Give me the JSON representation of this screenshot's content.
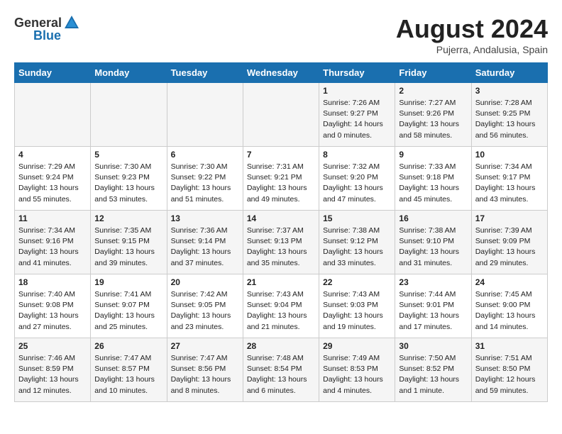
{
  "header": {
    "logo_general": "General",
    "logo_blue": "Blue",
    "month_year": "August 2024",
    "location": "Pujerra, Andalusia, Spain"
  },
  "days_of_week": [
    "Sunday",
    "Monday",
    "Tuesday",
    "Wednesday",
    "Thursday",
    "Friday",
    "Saturday"
  ],
  "weeks": [
    [
      {
        "day": "",
        "sunrise": "",
        "sunset": "",
        "daylight": ""
      },
      {
        "day": "",
        "sunrise": "",
        "sunset": "",
        "daylight": ""
      },
      {
        "day": "",
        "sunrise": "",
        "sunset": "",
        "daylight": ""
      },
      {
        "day": "",
        "sunrise": "",
        "sunset": "",
        "daylight": ""
      },
      {
        "day": "1",
        "sunrise": "Sunrise: 7:26 AM",
        "sunset": "Sunset: 9:27 PM",
        "daylight": "Daylight: 14 hours and 0 minutes."
      },
      {
        "day": "2",
        "sunrise": "Sunrise: 7:27 AM",
        "sunset": "Sunset: 9:26 PM",
        "daylight": "Daylight: 13 hours and 58 minutes."
      },
      {
        "day": "3",
        "sunrise": "Sunrise: 7:28 AM",
        "sunset": "Sunset: 9:25 PM",
        "daylight": "Daylight: 13 hours and 56 minutes."
      }
    ],
    [
      {
        "day": "4",
        "sunrise": "Sunrise: 7:29 AM",
        "sunset": "Sunset: 9:24 PM",
        "daylight": "Daylight: 13 hours and 55 minutes."
      },
      {
        "day": "5",
        "sunrise": "Sunrise: 7:30 AM",
        "sunset": "Sunset: 9:23 PM",
        "daylight": "Daylight: 13 hours and 53 minutes."
      },
      {
        "day": "6",
        "sunrise": "Sunrise: 7:30 AM",
        "sunset": "Sunset: 9:22 PM",
        "daylight": "Daylight: 13 hours and 51 minutes."
      },
      {
        "day": "7",
        "sunrise": "Sunrise: 7:31 AM",
        "sunset": "Sunset: 9:21 PM",
        "daylight": "Daylight: 13 hours and 49 minutes."
      },
      {
        "day": "8",
        "sunrise": "Sunrise: 7:32 AM",
        "sunset": "Sunset: 9:20 PM",
        "daylight": "Daylight: 13 hours and 47 minutes."
      },
      {
        "day": "9",
        "sunrise": "Sunrise: 7:33 AM",
        "sunset": "Sunset: 9:18 PM",
        "daylight": "Daylight: 13 hours and 45 minutes."
      },
      {
        "day": "10",
        "sunrise": "Sunrise: 7:34 AM",
        "sunset": "Sunset: 9:17 PM",
        "daylight": "Daylight: 13 hours and 43 minutes."
      }
    ],
    [
      {
        "day": "11",
        "sunrise": "Sunrise: 7:34 AM",
        "sunset": "Sunset: 9:16 PM",
        "daylight": "Daylight: 13 hours and 41 minutes."
      },
      {
        "day": "12",
        "sunrise": "Sunrise: 7:35 AM",
        "sunset": "Sunset: 9:15 PM",
        "daylight": "Daylight: 13 hours and 39 minutes."
      },
      {
        "day": "13",
        "sunrise": "Sunrise: 7:36 AM",
        "sunset": "Sunset: 9:14 PM",
        "daylight": "Daylight: 13 hours and 37 minutes."
      },
      {
        "day": "14",
        "sunrise": "Sunrise: 7:37 AM",
        "sunset": "Sunset: 9:13 PM",
        "daylight": "Daylight: 13 hours and 35 minutes."
      },
      {
        "day": "15",
        "sunrise": "Sunrise: 7:38 AM",
        "sunset": "Sunset: 9:12 PM",
        "daylight": "Daylight: 13 hours and 33 minutes."
      },
      {
        "day": "16",
        "sunrise": "Sunrise: 7:38 AM",
        "sunset": "Sunset: 9:10 PM",
        "daylight": "Daylight: 13 hours and 31 minutes."
      },
      {
        "day": "17",
        "sunrise": "Sunrise: 7:39 AM",
        "sunset": "Sunset: 9:09 PM",
        "daylight": "Daylight: 13 hours and 29 minutes."
      }
    ],
    [
      {
        "day": "18",
        "sunrise": "Sunrise: 7:40 AM",
        "sunset": "Sunset: 9:08 PM",
        "daylight": "Daylight: 13 hours and 27 minutes."
      },
      {
        "day": "19",
        "sunrise": "Sunrise: 7:41 AM",
        "sunset": "Sunset: 9:07 PM",
        "daylight": "Daylight: 13 hours and 25 minutes."
      },
      {
        "day": "20",
        "sunrise": "Sunrise: 7:42 AM",
        "sunset": "Sunset: 9:05 PM",
        "daylight": "Daylight: 13 hours and 23 minutes."
      },
      {
        "day": "21",
        "sunrise": "Sunrise: 7:43 AM",
        "sunset": "Sunset: 9:04 PM",
        "daylight": "Daylight: 13 hours and 21 minutes."
      },
      {
        "day": "22",
        "sunrise": "Sunrise: 7:43 AM",
        "sunset": "Sunset: 9:03 PM",
        "daylight": "Daylight: 13 hours and 19 minutes."
      },
      {
        "day": "23",
        "sunrise": "Sunrise: 7:44 AM",
        "sunset": "Sunset: 9:01 PM",
        "daylight": "Daylight: 13 hours and 17 minutes."
      },
      {
        "day": "24",
        "sunrise": "Sunrise: 7:45 AM",
        "sunset": "Sunset: 9:00 PM",
        "daylight": "Daylight: 13 hours and 14 minutes."
      }
    ],
    [
      {
        "day": "25",
        "sunrise": "Sunrise: 7:46 AM",
        "sunset": "Sunset: 8:59 PM",
        "daylight": "Daylight: 13 hours and 12 minutes."
      },
      {
        "day": "26",
        "sunrise": "Sunrise: 7:47 AM",
        "sunset": "Sunset: 8:57 PM",
        "daylight": "Daylight: 13 hours and 10 minutes."
      },
      {
        "day": "27",
        "sunrise": "Sunrise: 7:47 AM",
        "sunset": "Sunset: 8:56 PM",
        "daylight": "Daylight: 13 hours and 8 minutes."
      },
      {
        "day": "28",
        "sunrise": "Sunrise: 7:48 AM",
        "sunset": "Sunset: 8:54 PM",
        "daylight": "Daylight: 13 hours and 6 minutes."
      },
      {
        "day": "29",
        "sunrise": "Sunrise: 7:49 AM",
        "sunset": "Sunset: 8:53 PM",
        "daylight": "Daylight: 13 hours and 4 minutes."
      },
      {
        "day": "30",
        "sunrise": "Sunrise: 7:50 AM",
        "sunset": "Sunset: 8:52 PM",
        "daylight": "Daylight: 13 hours and 1 minute."
      },
      {
        "day": "31",
        "sunrise": "Sunrise: 7:51 AM",
        "sunset": "Sunset: 8:50 PM",
        "daylight": "Daylight: 12 hours and 59 minutes."
      }
    ]
  ]
}
